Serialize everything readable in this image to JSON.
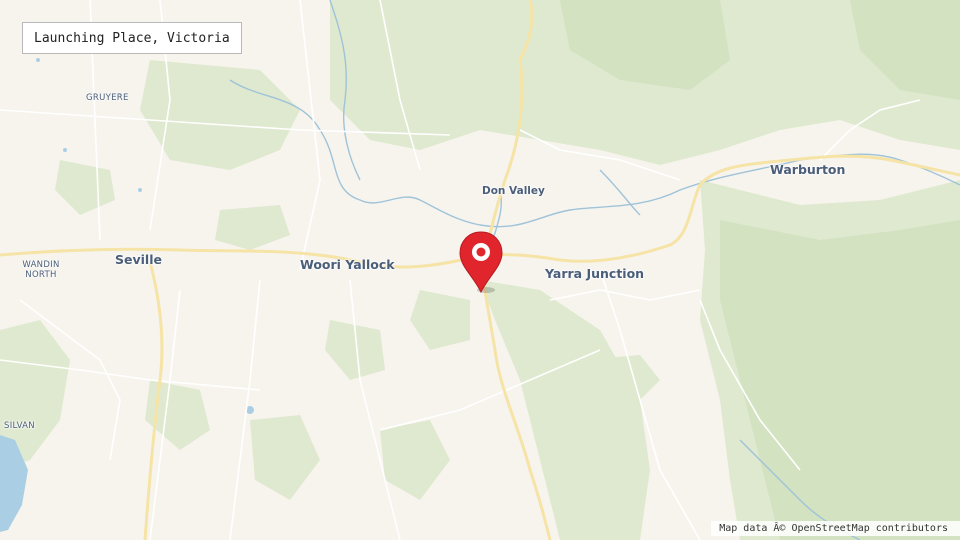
{
  "map": {
    "title": "Launching Place, Victoria",
    "attribution": "Map data Â© OpenStreetMap contributors",
    "marker_icon": "map-pin-icon",
    "colors": {
      "land": "#f7f4ee",
      "forest": "#dfe9cf",
      "forest_dark": "#d3e2c0",
      "road_major": "#f6e3a6",
      "road_minor": "#ffffff",
      "river": "#9fc3d8",
      "water": "#aacfe4",
      "marker": "#e0252d",
      "label": "#4a5e7a"
    },
    "places": {
      "seville": "Seville",
      "woori_yallock": "Woori Yallock",
      "yarra_junction": "Yarra Junction",
      "warburton": "Warburton",
      "don_valley": "Don Valley",
      "gruyere": "GRUYERE",
      "wandin_north": "WANDIN NORTH",
      "silvan": "SILVAN"
    }
  }
}
